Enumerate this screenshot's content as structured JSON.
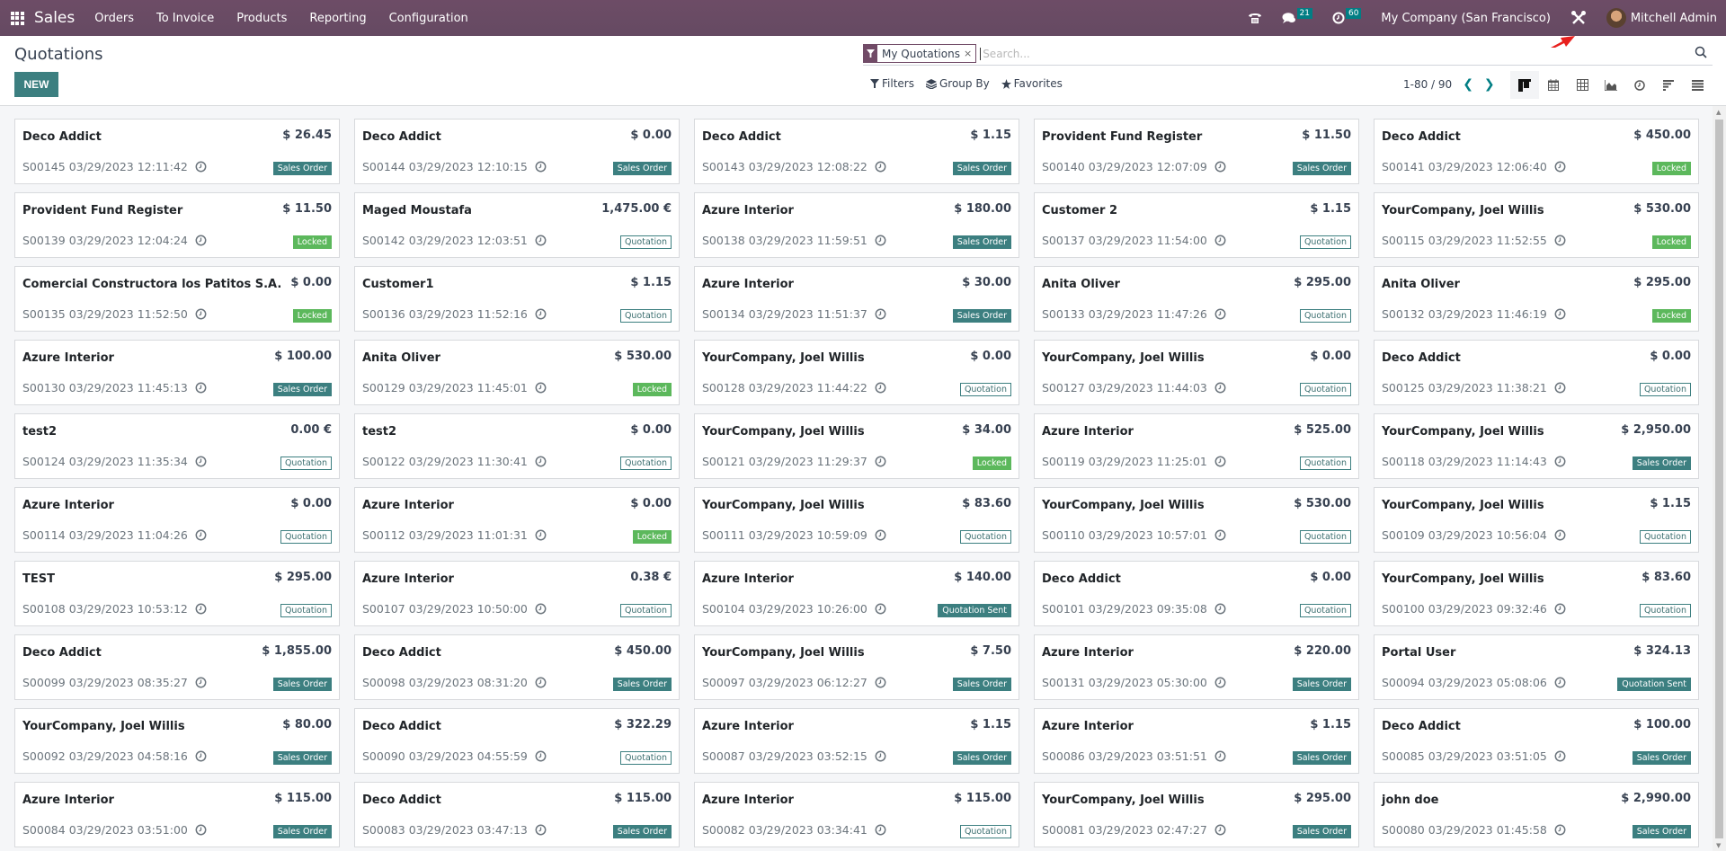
{
  "navbar": {
    "app_name": "Sales",
    "menus": [
      "Orders",
      "To Invoice",
      "Products",
      "Reporting",
      "Configuration"
    ],
    "messages_count": "21",
    "activities_count": "60",
    "company": "My Company (San Francisco)",
    "user": "Mitchell Admin",
    "icons": [
      "apps-grid-icon",
      "phone-icon",
      "chat-icon",
      "clock-icon",
      "debug-tools-icon"
    ]
  },
  "control": {
    "title": "Quotations",
    "new_label": "NEW",
    "facet_label": "My Quotations",
    "search_placeholder": "Search...",
    "filters_label": "Filters",
    "groupby_label": "Group By",
    "favorites_label": "Favorites",
    "pager": "1-80 / 90",
    "views": [
      "kanban",
      "calendar",
      "pivot",
      "graph",
      "activity",
      "gantt",
      "list"
    ],
    "active_view": "kanban"
  },
  "status_colors": {
    "Sales Order": "#3c7f80",
    "Locked": "#5cb85c",
    "Quotation": "#ffffff",
    "Quotation Sent": "#3c7f80"
  },
  "cards": [
    {
      "customer": "Deco Addict",
      "amount": "$ 26.45",
      "ref": "S00145",
      "date": "03/29/2023 12:11:42",
      "status": "Sales Order"
    },
    {
      "customer": "Deco Addict",
      "amount": "$ 0.00",
      "ref": "S00144",
      "date": "03/29/2023 12:10:15",
      "status": "Sales Order"
    },
    {
      "customer": "Deco Addict",
      "amount": "$ 1.15",
      "ref": "S00143",
      "date": "03/29/2023 12:08:22",
      "status": "Sales Order"
    },
    {
      "customer": "Provident Fund Register",
      "amount": "$ 11.50",
      "ref": "S00140",
      "date": "03/29/2023 12:07:09",
      "status": "Sales Order"
    },
    {
      "customer": "Deco Addict",
      "amount": "$ 450.00",
      "ref": "S00141",
      "date": "03/29/2023 12:06:40",
      "status": "Locked"
    },
    {
      "customer": "Provident Fund Register",
      "amount": "$ 11.50",
      "ref": "S00139",
      "date": "03/29/2023 12:04:24",
      "status": "Locked"
    },
    {
      "customer": "Maged Moustafa",
      "amount": "1,475.00 €",
      "ref": "S00142",
      "date": "03/29/2023 12:03:51",
      "status": "Quotation"
    },
    {
      "customer": "Azure Interior",
      "amount": "$ 180.00",
      "ref": "S00138",
      "date": "03/29/2023 11:59:51",
      "status": "Sales Order"
    },
    {
      "customer": "Customer 2",
      "amount": "$ 1.15",
      "ref": "S00137",
      "date": "03/29/2023 11:54:00",
      "status": "Quotation"
    },
    {
      "customer": "YourCompany, Joel Willis",
      "amount": "$ 530.00",
      "ref": "S00115",
      "date": "03/29/2023 11:52:55",
      "status": "Locked"
    },
    {
      "customer": "Comercial Constructora los Patitos S.A.",
      "amount": "$ 0.00",
      "ref": "S00135",
      "date": "03/29/2023 11:52:50",
      "status": "Locked"
    },
    {
      "customer": "Customer1",
      "amount": "$ 1.15",
      "ref": "S00136",
      "date": "03/29/2023 11:52:16",
      "status": "Quotation"
    },
    {
      "customer": "Azure Interior",
      "amount": "$ 30.00",
      "ref": "S00134",
      "date": "03/29/2023 11:51:37",
      "status": "Sales Order"
    },
    {
      "customer": "Anita Oliver",
      "amount": "$ 295.00",
      "ref": "S00133",
      "date": "03/29/2023 11:47:26",
      "status": "Quotation"
    },
    {
      "customer": "Anita Oliver",
      "amount": "$ 295.00",
      "ref": "S00132",
      "date": "03/29/2023 11:46:19",
      "status": "Locked"
    },
    {
      "customer": "Azure Interior",
      "amount": "$ 100.00",
      "ref": "S00130",
      "date": "03/29/2023 11:45:13",
      "status": "Sales Order"
    },
    {
      "customer": "Anita Oliver",
      "amount": "$ 530.00",
      "ref": "S00129",
      "date": "03/29/2023 11:45:01",
      "status": "Locked"
    },
    {
      "customer": "YourCompany, Joel Willis",
      "amount": "$ 0.00",
      "ref": "S00128",
      "date": "03/29/2023 11:44:22",
      "status": "Quotation"
    },
    {
      "customer": "YourCompany, Joel Willis",
      "amount": "$ 0.00",
      "ref": "S00127",
      "date": "03/29/2023 11:44:03",
      "status": "Quotation"
    },
    {
      "customer": "Deco Addict",
      "amount": "$ 0.00",
      "ref": "S00125",
      "date": "03/29/2023 11:38:21",
      "status": "Quotation"
    },
    {
      "customer": "test2",
      "amount": "0.00 €",
      "ref": "S00124",
      "date": "03/29/2023 11:35:34",
      "status": "Quotation"
    },
    {
      "customer": "test2",
      "amount": "$ 0.00",
      "ref": "S00122",
      "date": "03/29/2023 11:30:41",
      "status": "Quotation"
    },
    {
      "customer": "YourCompany, Joel Willis",
      "amount": "$ 34.00",
      "ref": "S00121",
      "date": "03/29/2023 11:29:37",
      "status": "Locked"
    },
    {
      "customer": "Azure Interior",
      "amount": "$ 525.00",
      "ref": "S00119",
      "date": "03/29/2023 11:25:01",
      "status": "Quotation"
    },
    {
      "customer": "YourCompany, Joel Willis",
      "amount": "$ 2,950.00",
      "ref": "S00118",
      "date": "03/29/2023 11:14:43",
      "status": "Sales Order"
    },
    {
      "customer": "Azure Interior",
      "amount": "$ 0.00",
      "ref": "S00114",
      "date": "03/29/2023 11:04:26",
      "status": "Quotation"
    },
    {
      "customer": "Azure Interior",
      "amount": "$ 0.00",
      "ref": "S00112",
      "date": "03/29/2023 11:01:31",
      "status": "Locked"
    },
    {
      "customer": "YourCompany, Joel Willis",
      "amount": "$ 83.60",
      "ref": "S00111",
      "date": "03/29/2023 10:59:09",
      "status": "Quotation"
    },
    {
      "customer": "YourCompany, Joel Willis",
      "amount": "$ 530.00",
      "ref": "S00110",
      "date": "03/29/2023 10:57:01",
      "status": "Quotation"
    },
    {
      "customer": "YourCompany, Joel Willis",
      "amount": "$ 1.15",
      "ref": "S00109",
      "date": "03/29/2023 10:56:04",
      "status": "Quotation"
    },
    {
      "customer": "TEST",
      "amount": "$ 295.00",
      "ref": "S00108",
      "date": "03/29/2023 10:53:12",
      "status": "Quotation"
    },
    {
      "customer": "Azure Interior",
      "amount": "0.38 €",
      "ref": "S00107",
      "date": "03/29/2023 10:50:00",
      "status": "Quotation"
    },
    {
      "customer": "Azure Interior",
      "amount": "$ 140.00",
      "ref": "S00104",
      "date": "03/29/2023 10:26:00",
      "status": "Quotation Sent"
    },
    {
      "customer": "Deco Addict",
      "amount": "$ 0.00",
      "ref": "S00101",
      "date": "03/29/2023 09:35:08",
      "status": "Quotation"
    },
    {
      "customer": "YourCompany, Joel Willis",
      "amount": "$ 83.60",
      "ref": "S00100",
      "date": "03/29/2023 09:32:46",
      "status": "Quotation"
    },
    {
      "customer": "Deco Addict",
      "amount": "$ 1,855.00",
      "ref": "S00099",
      "date": "03/29/2023 08:35:27",
      "status": "Sales Order"
    },
    {
      "customer": "Deco Addict",
      "amount": "$ 450.00",
      "ref": "S00098",
      "date": "03/29/2023 08:31:20",
      "status": "Sales Order"
    },
    {
      "customer": "YourCompany, Joel Willis",
      "amount": "$ 7.50",
      "ref": "S00097",
      "date": "03/29/2023 06:12:27",
      "status": "Sales Order"
    },
    {
      "customer": "Azure Interior",
      "amount": "$ 220.00",
      "ref": "S00131",
      "date": "03/29/2023 05:30:00",
      "status": "Sales Order"
    },
    {
      "customer": "Portal User",
      "amount": "$ 324.13",
      "ref": "S00094",
      "date": "03/29/2023 05:08:06",
      "status": "Quotation Sent"
    },
    {
      "customer": "YourCompany, Joel Willis",
      "amount": "$ 80.00",
      "ref": "S00092",
      "date": "03/29/2023 04:58:16",
      "status": "Sales Order"
    },
    {
      "customer": "Deco Addict",
      "amount": "$ 322.29",
      "ref": "S00090",
      "date": "03/29/2023 04:55:59",
      "status": "Quotation"
    },
    {
      "customer": "Azure Interior",
      "amount": "$ 1.15",
      "ref": "S00087",
      "date": "03/29/2023 03:52:15",
      "status": "Sales Order"
    },
    {
      "customer": "Azure Interior",
      "amount": "$ 1.15",
      "ref": "S00086",
      "date": "03/29/2023 03:51:51",
      "status": "Sales Order"
    },
    {
      "customer": "Deco Addict",
      "amount": "$ 100.00",
      "ref": "S00085",
      "date": "03/29/2023 03:51:05",
      "status": "Sales Order"
    },
    {
      "customer": "Azure Interior",
      "amount": "$ 115.00",
      "ref": "S00084",
      "date": "03/29/2023 03:51:00",
      "status": "Sales Order"
    },
    {
      "customer": "Deco Addict",
      "amount": "$ 115.00",
      "ref": "S00083",
      "date": "03/29/2023 03:47:13",
      "status": "Sales Order"
    },
    {
      "customer": "Azure Interior",
      "amount": "$ 115.00",
      "ref": "S00082",
      "date": "03/29/2023 03:34:41",
      "status": "Quotation"
    },
    {
      "customer": "YourCompany, Joel Willis",
      "amount": "$ 295.00",
      "ref": "S00081",
      "date": "03/29/2023 02:47:27",
      "status": "Sales Order"
    },
    {
      "customer": "john doe",
      "amount": "$ 2,990.00",
      "ref": "S00080",
      "date": "03/29/2023 01:45:58",
      "status": "Sales Order"
    }
  ]
}
